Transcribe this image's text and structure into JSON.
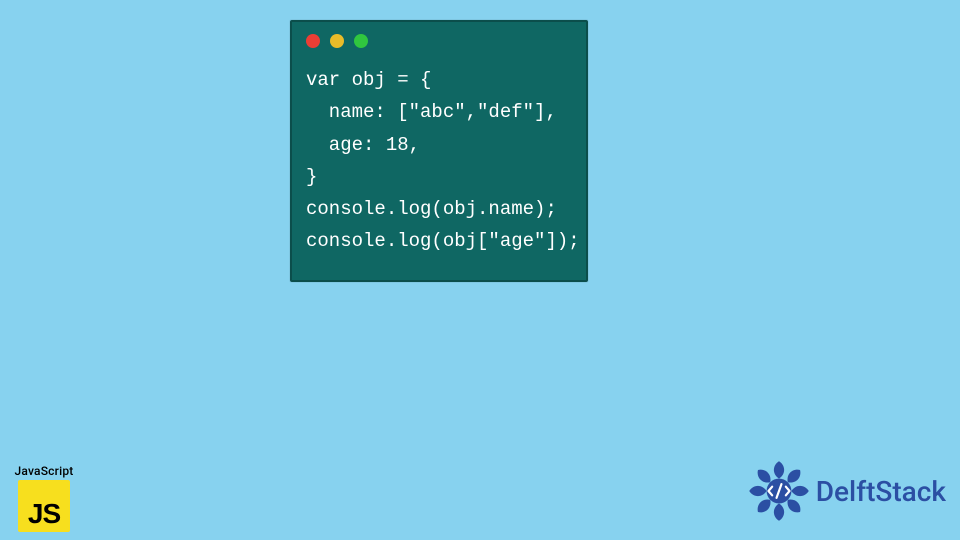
{
  "code_window": {
    "lines": [
      "var obj = {",
      "  name: [\"abc\",\"def\"],",
      "  age: 18,",
      "}",
      "console.log(obj.name);",
      "console.log(obj[\"age\"]);"
    ],
    "dots": [
      "red",
      "yellow",
      "green"
    ]
  },
  "badges": {
    "javascript": {
      "label": "JavaScript",
      "mark": "JS"
    }
  },
  "brand": {
    "name": "DelftStack"
  },
  "colors": {
    "bg": "#87d2ef",
    "window_bg": "#0f6763",
    "js_yellow": "#f7df1e",
    "delft_blue": "#2b4fa3"
  }
}
